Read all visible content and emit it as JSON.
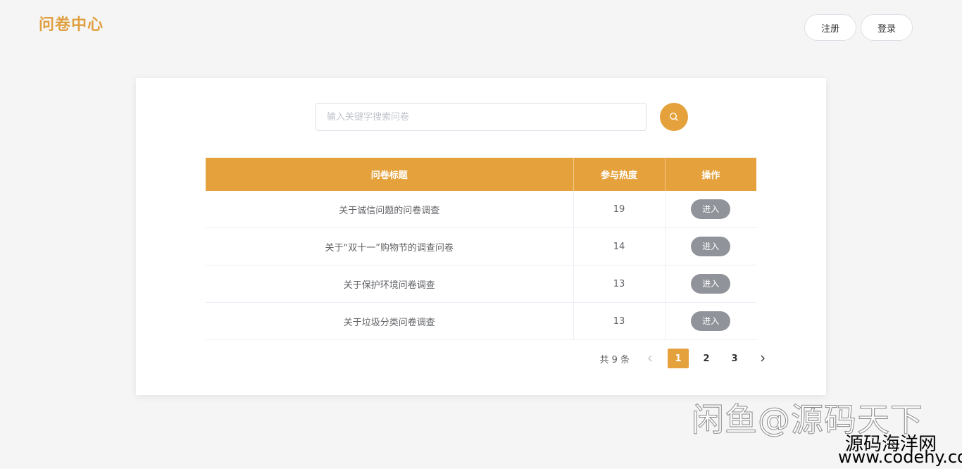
{
  "header": {
    "logo": "问卷中心",
    "register_label": "注册",
    "login_label": "登录"
  },
  "search": {
    "placeholder": "输入关键字搜索问卷"
  },
  "table": {
    "headers": [
      "问卷标题",
      "参与热度",
      "操作"
    ],
    "rows": [
      {
        "title": "关于诚信问题的问卷调查",
        "heat": "19",
        "action": "进入"
      },
      {
        "title": "关于“双十一”购物节的调查问卷",
        "heat": "14",
        "action": "进入"
      },
      {
        "title": "关于保护环境问卷调查",
        "heat": "13",
        "action": "进入"
      },
      {
        "title": "关于垃圾分类问卷调查",
        "heat": "13",
        "action": "进入"
      }
    ]
  },
  "pagination": {
    "total": "共 9 条",
    "pages": [
      "1",
      "2",
      "3"
    ],
    "current": "1"
  },
  "watermark": {
    "line1": "闲鱼@源码天下",
    "line2": "源码海洋网",
    "line3": "www.codehy.com"
  },
  "colors": {
    "accent": "#e5a13b",
    "logo": "#e09f3e",
    "button_gray": "#909399"
  },
  "icons": {
    "search": "search-icon",
    "prev": "chevron-left-icon",
    "next": "chevron-right-icon"
  }
}
